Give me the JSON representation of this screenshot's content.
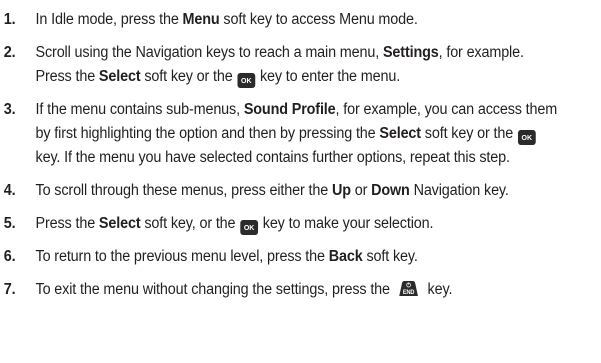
{
  "ok_key": {
    "label": "OK",
    "icon": "ok-key-icon"
  },
  "end_key": {
    "label": "END",
    "icon": "end-power-key-icon"
  },
  "steps": [
    {
      "num": "1.",
      "parts": [
        "In Idle mode, press the ",
        "Menu",
        " soft key to access Menu mode."
      ]
    },
    {
      "num": "2.",
      "parts": [
        "Scroll using the Navigation keys to reach a main menu, ",
        "Settings",
        ", for example. Press the ",
        "Select",
        " soft key or the ",
        " key to enter the menu."
      ]
    },
    {
      "num": "3.",
      "parts": [
        "If the menu contains sub-menus, ",
        "Sound Profile",
        ", for example, you can access them by first highlighting the option and then by pressing the ",
        "Select",
        " soft key or the ",
        " key. If the menu you have selected contains further options, repeat this step."
      ]
    },
    {
      "num": "4.",
      "parts": [
        "To scroll through these menus, press either the ",
        "Up",
        " or ",
        "Down",
        " Navigation key."
      ]
    },
    {
      "num": "5.",
      "parts": [
        " Press the ",
        "Select",
        " soft key, or the ",
        " key to make your selection."
      ]
    },
    {
      "num": "6.",
      "parts": [
        "To return to the previous menu level, press the ",
        "Back",
        " soft key."
      ]
    },
    {
      "num": "7.",
      "parts": [
        "To exit the menu without changing the settings, press the ",
        " key."
      ]
    }
  ]
}
